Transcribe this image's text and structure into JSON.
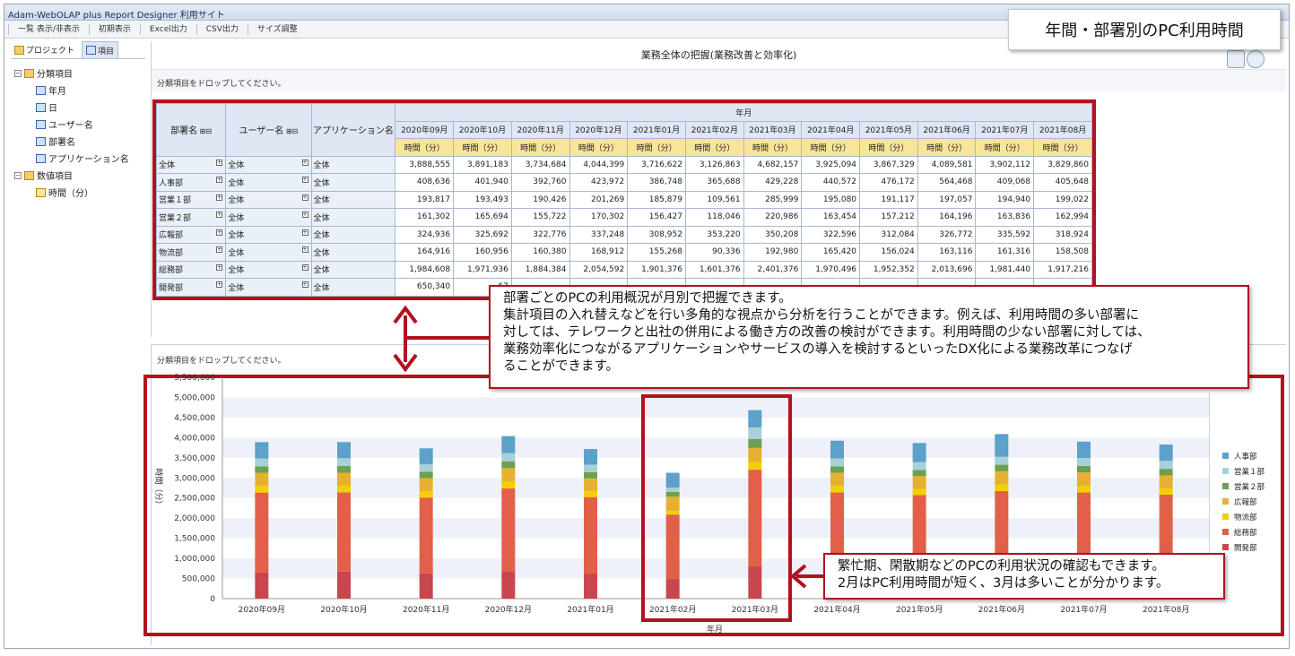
{
  "window": {
    "title": "Adam-WebOLAP plus Report Designer 利用サイト"
  },
  "menubar": [
    "一覧 表示/非表示",
    "初期表示",
    "Excel出力",
    "CSV出力",
    "サイズ調整"
  ],
  "badge": "年間・部署別のPC利用時間",
  "sidebar": {
    "tabs": [
      "プロジェクト",
      "項目"
    ],
    "tree": [
      {
        "label": "分類項目",
        "level": 0,
        "icon": "folder-icon"
      },
      {
        "label": "年月",
        "level": 1,
        "icon": "dimension-icon"
      },
      {
        "label": "日",
        "level": 1,
        "icon": "dimension-icon"
      },
      {
        "label": "ユーザー名",
        "level": 1,
        "icon": "dimension-icon"
      },
      {
        "label": "部署名",
        "level": 1,
        "icon": "dimension-icon"
      },
      {
        "label": "アプリケーション名",
        "level": 1,
        "icon": "dimension-icon"
      },
      {
        "label": "数値項目",
        "level": 0,
        "icon": "folder-icon"
      },
      {
        "label": "時間（分）",
        "level": 1,
        "icon": "measure-icon"
      }
    ]
  },
  "pivot": {
    "pane_title": "業務全体の把握(業務改善と効率化)",
    "drop_hint": "分類項目をドロップしてください。",
    "row_headers": [
      "部署名",
      "ユーザー名",
      "アプリケーション名"
    ],
    "col_group": "年月",
    "months": [
      "2020年09月",
      "2020年10月",
      "2020年11月",
      "2020年12月",
      "2021年01月",
      "2021年02月",
      "2021年03月",
      "2021年04月",
      "2021年05月",
      "2021年06月",
      "2021年07月",
      "2021年08月"
    ],
    "measure": "時間（分）",
    "rows": [
      {
        "dept": "全体",
        "user": "全体",
        "app": "全体",
        "values": [
          "3,888,555",
          "3,891,183",
          "3,734,684",
          "4,044,399",
          "3,716,622",
          "3,126,863",
          "4,682,157",
          "3,925,094",
          "3,867,329",
          "4,089,581",
          "3,902,112",
          "3,829,860"
        ]
      },
      {
        "dept": "人事部",
        "user": "全体",
        "app": "全体",
        "values": [
          "408,636",
          "401,940",
          "392,760",
          "423,972",
          "386,748",
          "365,688",
          "429,228",
          "440,572",
          "476,172",
          "564,468",
          "409,068",
          "405,648"
        ]
      },
      {
        "dept": "営業１部",
        "user": "全体",
        "app": "全体",
        "values": [
          "193,817",
          "193,493",
          "190,426",
          "201,269",
          "185,879",
          "109,561",
          "285,999",
          "195,080",
          "191,117",
          "197,057",
          "194,940",
          "199,022"
        ]
      },
      {
        "dept": "営業２部",
        "user": "全体",
        "app": "全体",
        "values": [
          "161,302",
          "165,694",
          "155,722",
          "170,302",
          "156,427",
          "118,046",
          "220,986",
          "163,454",
          "157,212",
          "164,196",
          "163,836",
          "162,994"
        ]
      },
      {
        "dept": "広報部",
        "user": "全体",
        "app": "全体",
        "values": [
          "324,936",
          "325,692",
          "322,776",
          "337,248",
          "308,952",
          "353,220",
          "350,208",
          "322,596",
          "312,084",
          "326,772",
          "335,592",
          "318,924"
        ]
      },
      {
        "dept": "物流部",
        "user": "全体",
        "app": "全体",
        "values": [
          "164,916",
          "160,956",
          "160,380",
          "168,912",
          "155,268",
          "90,336",
          "192,980",
          "165,420",
          "156,024",
          "163,116",
          "161,316",
          "158,508"
        ]
      },
      {
        "dept": "総務部",
        "user": "全体",
        "app": "全体",
        "values": [
          "1,984,608",
          "1,971,936",
          "1,884,384",
          "2,054,592",
          "1,901,376",
          "1,601,376",
          "2,401,376",
          "1,970,496",
          "1,952,352",
          "2,013,696",
          "1,981,440",
          "1,917,216"
        ]
      },
      {
        "dept": "開発部",
        "user": "全体",
        "app": "全体",
        "values": [
          "650,340",
          "67",
          "",
          "",
          "",
          "",
          "",
          "",
          "",
          "",
          "",
          ""
        ]
      }
    ]
  },
  "callout_top": [
    "部署ごとのPCの利用概況が月別で把握できます。",
    "集計項目の入れ替えなどを行い多角的な視点から分析を行うことができます。例えば、利用時間の多い部署に",
    "対しては、テレワークと出社の併用による働き方の改善の検討ができます。利用時間の少ない部署に対しては、",
    "業務効率化につながるアプリケーションやサービスの導入を検討するといったDX化による業務改革につなげ",
    "ることができます。"
  ],
  "callout_bottom": [
    "繁忙期、閑散期などのPCの利用状況の確認もできます。",
    "2月はPC利用時間が短く、3月は多いことが分かります。"
  ],
  "chart_pane": {
    "drop_hint": "分類項目をドロップしてください。"
  },
  "colors": {
    "frame_red": "#b1121e",
    "開発部": "#c8474f",
    "総務部": "#e2604a",
    "物流部": "#f2d000",
    "広報部": "#e8b030",
    "営業２部": "#6e9f4e",
    "営業１部": "#a8d0d8",
    "人事部": "#5ba1c9"
  },
  "chart_data": {
    "type": "bar",
    "stacked": true,
    "categories": [
      "2020年09月",
      "2020年10月",
      "2020年11月",
      "2020年12月",
      "2021年01月",
      "2021年02月",
      "2021年03月",
      "2021年04月",
      "2021年05月",
      "2021年06月",
      "2021年07月",
      "2021年08月"
    ],
    "ylabel": "時間（分）",
    "xlabel": "年月",
    "ylim": [
      0,
      5500000
    ],
    "yticks": [
      "0",
      "500,000",
      "1,000,000",
      "1,500,000",
      "2,000,000",
      "2,500,000",
      "3,000,000",
      "3,500,000",
      "4,000,000",
      "4,500,000",
      "5,000,000",
      "5,500,000"
    ],
    "legend_position": "right",
    "series": [
      {
        "name": "開発部",
        "values": [
          650340,
          670000,
          628000,
          683000,
          622000,
          489000,
          802000,
          667000,
          622000,
          660000,
          656000,
          667000
        ]
      },
      {
        "name": "総務部",
        "values": [
          1984608,
          1971936,
          1884384,
          2054592,
          1901376,
          1601376,
          2401376,
          1970496,
          1952352,
          2013696,
          1981440,
          1917216
        ]
      },
      {
        "name": "物流部",
        "values": [
          164916,
          160956,
          160380,
          168912,
          155268,
          90336,
          192980,
          165420,
          156024,
          163116,
          161316,
          158508
        ]
      },
      {
        "name": "広報部",
        "values": [
          324936,
          325692,
          322776,
          337248,
          308952,
          353220,
          350208,
          322596,
          312084,
          326772,
          335592,
          318924
        ]
      },
      {
        "name": "営業２部",
        "values": [
          161302,
          165694,
          155722,
          170302,
          156427,
          118046,
          220986,
          163454,
          157212,
          164196,
          163836,
          162994
        ]
      },
      {
        "name": "営業１部",
        "values": [
          193817,
          193493,
          190426,
          201269,
          185879,
          109561,
          285999,
          195080,
          191117,
          197057,
          194940,
          199022
        ]
      },
      {
        "name": "人事部",
        "values": [
          408636,
          401940,
          392760,
          423972,
          386748,
          365688,
          429228,
          440572,
          476172,
          564468,
          409068,
          405648
        ]
      }
    ],
    "legend_order": [
      "人事部",
      "営業１部",
      "営業２部",
      "広報部",
      "物流部",
      "総務部",
      "開発部"
    ]
  }
}
